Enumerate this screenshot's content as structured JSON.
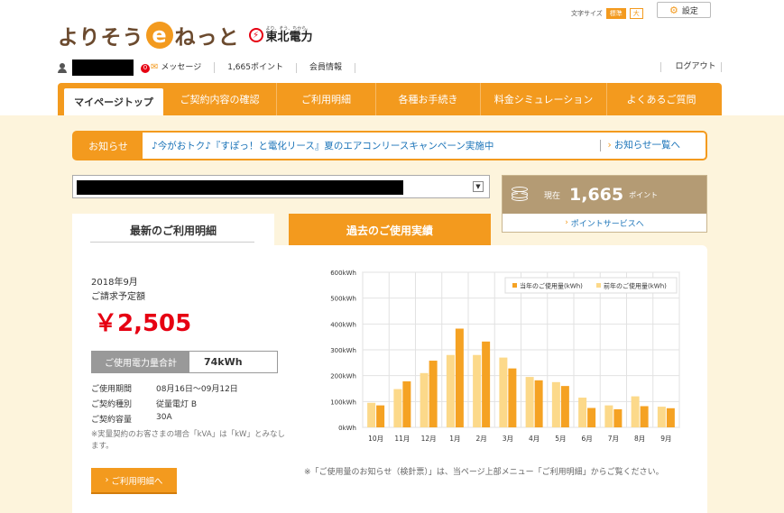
{
  "header": {
    "logo_text_pre": "よりそう",
    "logo_e": "e",
    "logo_text_post": "ねっと",
    "company_tagline": "より、そう、ちから。",
    "company_name": "東北電力",
    "font_size_label": "文字サイズ",
    "font_size_standard": "標準",
    "font_size_large": "大",
    "settings_label": "設定"
  },
  "userbar": {
    "messages_count": "0",
    "messages_label": "メッセージ",
    "points_label": "1,665ポイント",
    "member_info": "会員情報",
    "logout": "ログアウト"
  },
  "nav": {
    "tabs": [
      {
        "label": "マイページトップ",
        "active": true
      },
      {
        "label": "ご契約内容の確認"
      },
      {
        "label": "ご利用明細"
      },
      {
        "label": "各種お手続き"
      },
      {
        "label": "料金シミュレーション"
      },
      {
        "label": "よくあるご質問"
      }
    ]
  },
  "notice": {
    "label": "お知らせ",
    "text": "♪今がおトク♪『すぽっ！と電化リース』夏のエアコンリースキャンペーン実施中",
    "link": "お知らせ一覧へ"
  },
  "points": {
    "current_label": "現在",
    "value": "1,665",
    "unit": "ポイント",
    "link": "ポイントサービスへ"
  },
  "tabs": {
    "latest": "最新のご利用明細",
    "past": "過去のご使用実績"
  },
  "bill": {
    "month": "2018年9月",
    "label": "ご請求予定額",
    "amount": "￥2,505",
    "usage_label": "ご使用電力量合計",
    "usage_value": "74kWh",
    "details": [
      {
        "key": "ご使用期間",
        "value": "08月16日～09月12日"
      },
      {
        "key": "ご契約種別",
        "value": "従量電灯 B"
      },
      {
        "key": "ご契約容量",
        "value": "30A"
      }
    ],
    "footnote": "※実量契約のお客さまの場合「kVA」は「kW」とみなします。",
    "detail_button": "ご利用明細へ"
  },
  "chart_note": "※「ご使用量のお知らせ（検針票）」は、当ページ上部メニュー「ご利用明細」からご覧ください。",
  "colors": {
    "accent": "#f39a1e",
    "current_year": "#f5a223",
    "prev_year": "#fcd98a",
    "amount_red": "#e60012"
  },
  "chart_data": {
    "type": "bar",
    "categories": [
      "10月",
      "11月",
      "12月",
      "1月",
      "2月",
      "3月",
      "4月",
      "5月",
      "6月",
      "7月",
      "8月",
      "9月"
    ],
    "series": [
      {
        "name": "前年のご使用量(kWh)",
        "values": [
          95,
          148,
          210,
          280,
          280,
          270,
          195,
          175,
          115,
          85,
          120,
          80
        ]
      },
      {
        "name": "当年のご使用量(kWh)",
        "values": [
          85,
          178,
          258,
          382,
          332,
          228,
          182,
          160,
          75,
          70,
          82,
          74
        ]
      }
    ],
    "ylim": [
      0,
      600
    ],
    "yticks": [
      "0kWh",
      "100kWh",
      "200kWh",
      "300kWh",
      "400kWh",
      "500kWh",
      "600kWh"
    ],
    "grid": true,
    "legend_position": "top-right"
  }
}
